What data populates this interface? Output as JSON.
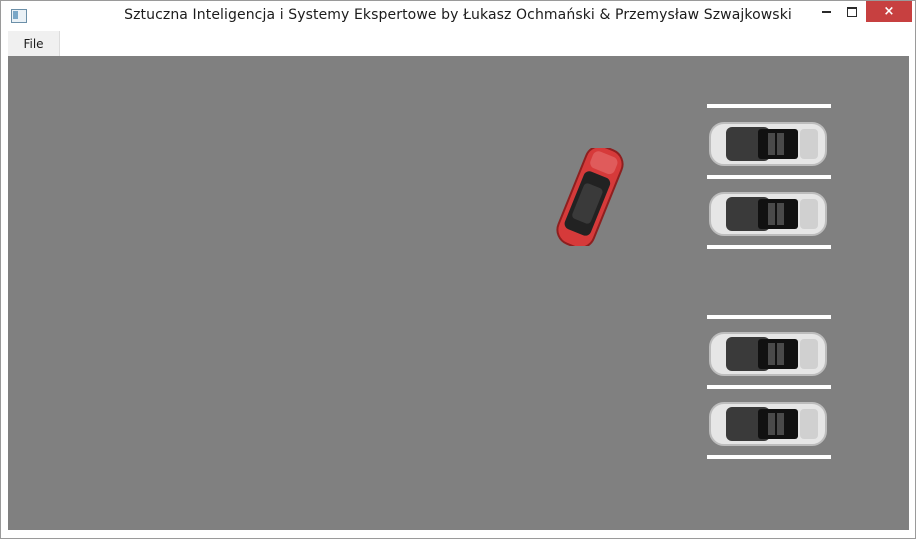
{
  "window": {
    "title": "Sztuczna Inteligencja i Systemy Ekspertowe by Łukasz Ochmański & Przemysław Szwajkowski",
    "controls": {
      "minimize": "minimize-icon",
      "maximize": "maximize-icon",
      "close": "×"
    }
  },
  "menu": {
    "items": [
      {
        "label": "File"
      }
    ]
  },
  "scene": {
    "background_color": "#808080",
    "line_color": "#ffffff",
    "player_car_color": "#d63a3a",
    "parked_car_color": "#e6e6e6"
  }
}
